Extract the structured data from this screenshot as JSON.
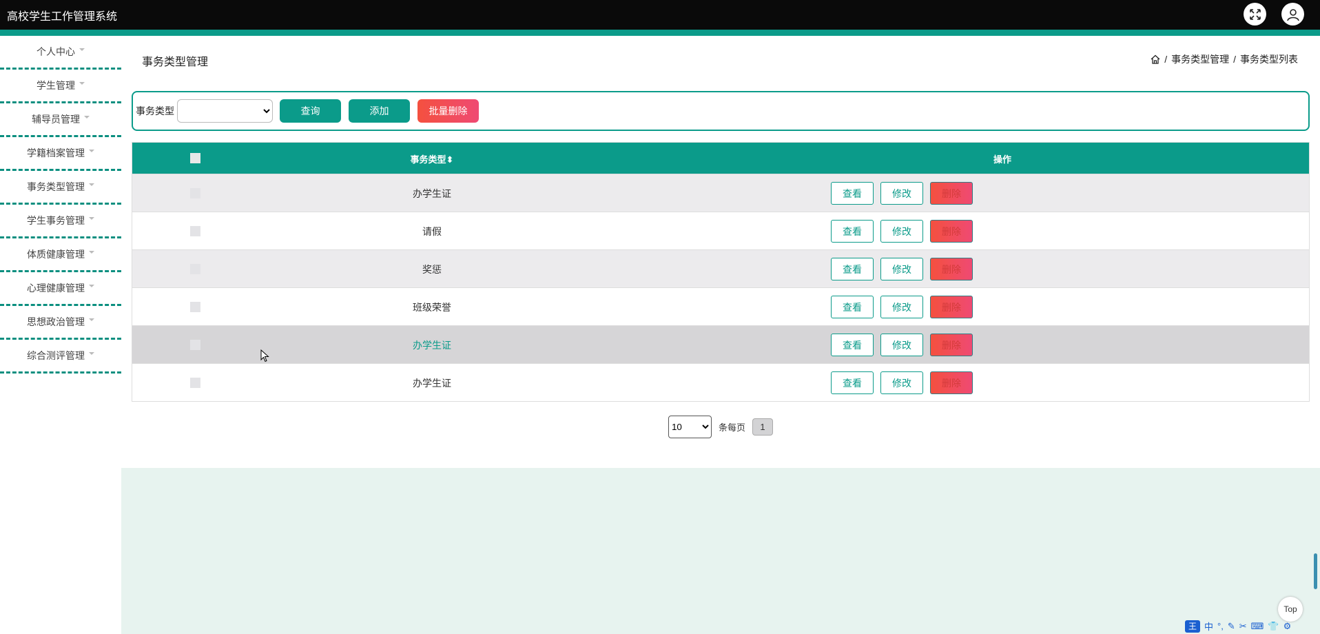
{
  "app": {
    "title": "高校学生工作管理系统"
  },
  "header_icons": [
    "fullscreen-icon",
    "user-icon"
  ],
  "sidebar": {
    "items": [
      {
        "label": "个人中心"
      },
      {
        "label": "学生管理"
      },
      {
        "label": "辅导员管理"
      },
      {
        "label": "学籍档案管理"
      },
      {
        "label": "事务类型管理"
      },
      {
        "label": "学生事务管理"
      },
      {
        "label": "体质健康管理"
      },
      {
        "label": "心理健康管理"
      },
      {
        "label": "思想政治管理"
      },
      {
        "label": "综合测评管理"
      }
    ]
  },
  "page": {
    "title": "事务类型管理",
    "breadcrumb": [
      "事务类型管理",
      "事务类型列表"
    ],
    "breadcrumb_sep": "/"
  },
  "search": {
    "label": "事务类型",
    "selected": "",
    "query_btn": "查询",
    "add_btn": "添加",
    "batch_delete_btn": "批量删除"
  },
  "table": {
    "headers": {
      "name": "事务类型",
      "ops": "操作"
    },
    "sort_icon": "sort-icon",
    "rows": [
      {
        "name": "办学生证"
      },
      {
        "name": "请假"
      },
      {
        "name": "奖惩"
      },
      {
        "name": "班级荣誉"
      },
      {
        "name": "办学生证"
      },
      {
        "name": "办学生证"
      }
    ],
    "row_actions": {
      "view": "查看",
      "edit": "修改",
      "delete": "删除"
    }
  },
  "pager": {
    "page_size": "10",
    "per_page_label": "条每页",
    "current_page": "1"
  },
  "back_to_top": "Top",
  "ime": {
    "logo": "王",
    "mode": "中"
  },
  "colors": {
    "accent": "#0b9b8a",
    "danger": "#f4503f",
    "topbar": "#0a0a0a"
  }
}
